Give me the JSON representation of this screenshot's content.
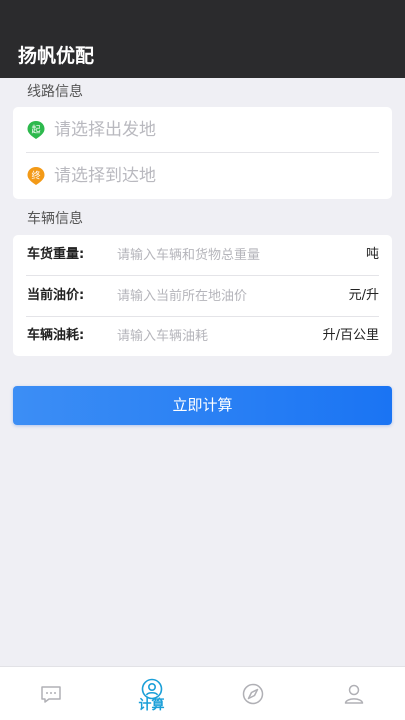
{
  "app": {
    "title": "扬帆优配"
  },
  "route": {
    "section_title": "线路信息",
    "start": {
      "badge": "起",
      "placeholder": "请选择出发地",
      "color": "#2db94d"
    },
    "end": {
      "badge": "终",
      "placeholder": "请选择到达地",
      "color": "#f39a17"
    }
  },
  "vehicle": {
    "section_title": "车辆信息",
    "fields": [
      {
        "label": "车货重量:",
        "placeholder": "请输入车辆和货物总重量",
        "value": "",
        "unit": "吨"
      },
      {
        "label": "当前油价:",
        "placeholder": "请输入当前所在地油价",
        "value": "",
        "unit": "元/升"
      },
      {
        "label": "车辆油耗:",
        "placeholder": "请输入车辆油耗",
        "value": "",
        "unit": "升/百公里"
      }
    ]
  },
  "actions": {
    "calculate_label": "立即计算"
  },
  "tabbar": {
    "active_color": "#1a9fd8",
    "inactive_color": "#b0b0b5",
    "tabs": [
      {
        "icon": "message-icon",
        "label": ""
      },
      {
        "icon": "user-circle-icon",
        "label": "计算",
        "active": true
      },
      {
        "icon": "compass-icon",
        "label": ""
      },
      {
        "icon": "profile-icon",
        "label": ""
      }
    ]
  }
}
